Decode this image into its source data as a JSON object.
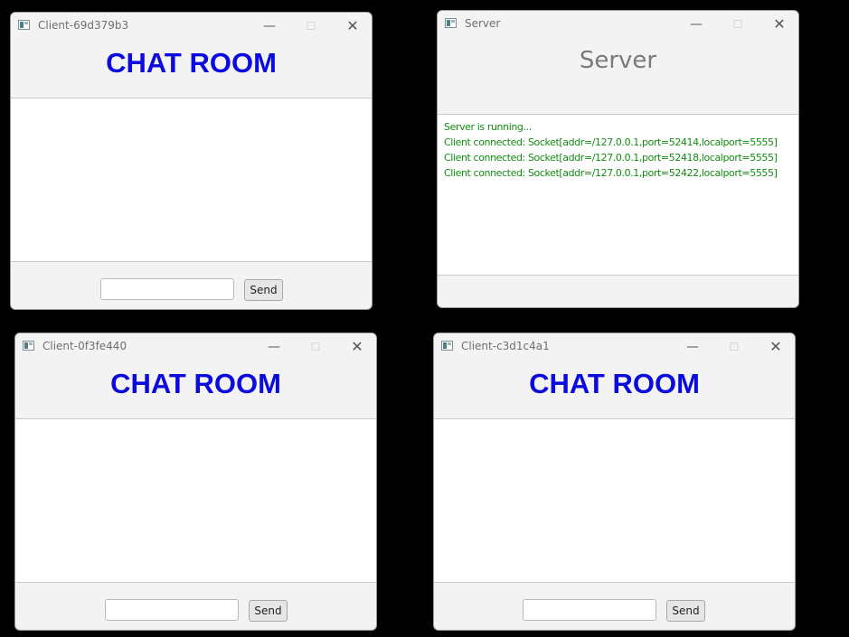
{
  "windows": {
    "client1": {
      "title": "Client-69d379b3",
      "heading": "CHAT ROOM",
      "input_value": "",
      "send_label": "Send"
    },
    "server": {
      "title": "Server",
      "heading": "Server",
      "log": [
        "Server is running...",
        "Client connected: Socket[addr=/127.0.0.1,port=52414,localport=5555]",
        "Client connected: Socket[addr=/127.0.0.1,port=52418,localport=5555]",
        "Client connected: Socket[addr=/127.0.0.1,port=52422,localport=5555]"
      ]
    },
    "client2": {
      "title": "Client-0f3fe440",
      "heading": "CHAT ROOM",
      "input_value": "",
      "send_label": "Send"
    },
    "client3": {
      "title": "Client-c3d1c4a1",
      "heading": "CHAT ROOM",
      "input_value": "",
      "send_label": "Send"
    }
  },
  "controls": {
    "minimize": "—",
    "maximize": "☐",
    "close": "✕"
  },
  "colors": {
    "chat_title": "#0b0bde",
    "log_text": "#128c12",
    "server_title": "#7a7a7a",
    "desktop": "#000000"
  }
}
